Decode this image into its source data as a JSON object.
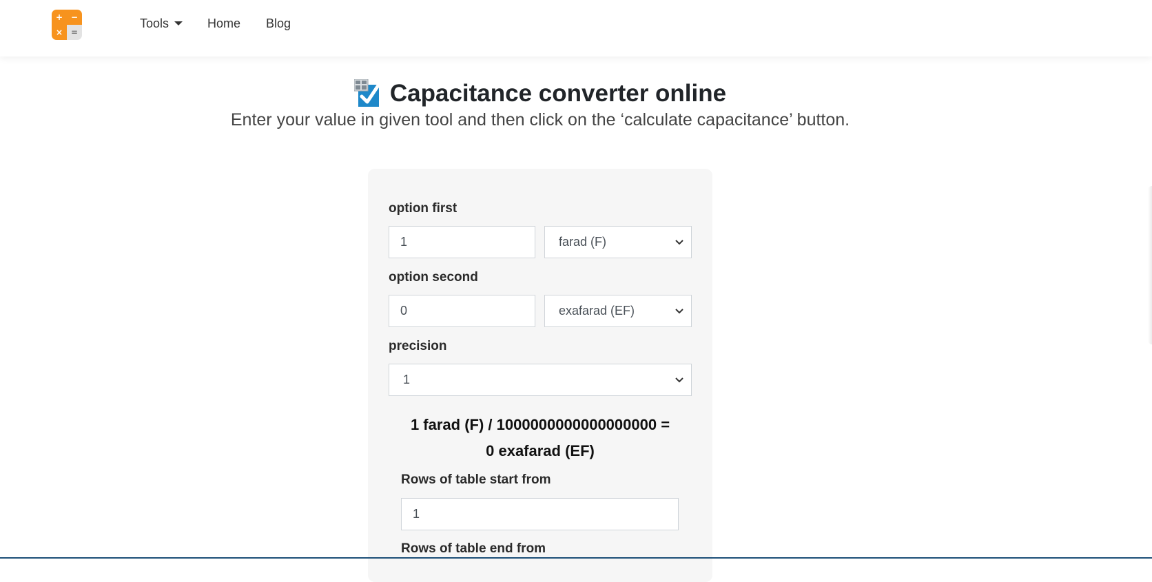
{
  "nav": {
    "items": [
      {
        "label": "Tools",
        "has_dropdown": true
      },
      {
        "label": "Home"
      },
      {
        "label": "Blog"
      }
    ],
    "logo_symbols": [
      "+",
      "−",
      "×",
      "="
    ]
  },
  "page": {
    "title": "Capacitance converter online",
    "subtitle": "Enter your value in given tool and then click on the ‘calculate capacitance’ button."
  },
  "form": {
    "option_first": {
      "label": "option first",
      "value": "1",
      "unit": "farad (F)"
    },
    "option_second": {
      "label": "option second",
      "value": "0",
      "unit": "exafarad (EF)"
    },
    "precision": {
      "label": "precision",
      "value": "1"
    },
    "result": {
      "line1": "1 farad (F) / 1000000000000000000 =",
      "line2": "0 exafarad (EF)"
    },
    "rows_start": {
      "label": "Rows of table start from",
      "value": "1"
    },
    "rows_end": {
      "label": "Rows of table end from"
    }
  },
  "colors": {
    "logo_orange": "#f7931e",
    "card_bg": "#f6f6f6",
    "checkbox_blue": "#1e88c9"
  },
  "icons": {
    "logo": "calculator-icon",
    "title": "checkbox-checked-icon",
    "dropdown": "chevron-down-icon"
  }
}
